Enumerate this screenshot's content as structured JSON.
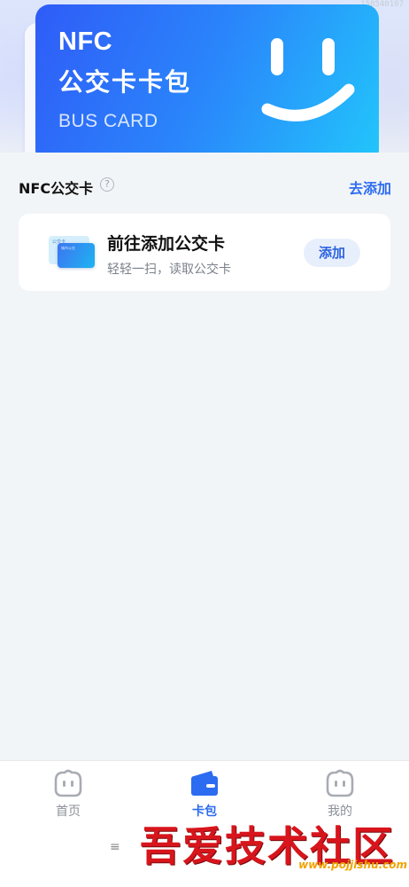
{
  "hero": {
    "id_text": "158540107",
    "card": {
      "nfc": "NFC",
      "title": "公交卡卡包",
      "subtitle": "BUS CARD"
    }
  },
  "section": {
    "title": "NFC公交卡",
    "help": "?",
    "link": "去添加"
  },
  "add_card": {
    "mini_back_label": "公交卡",
    "mini_front_label": "城市公交",
    "title": "前往添加公交卡",
    "description": "轻轻一扫，读取公交卡",
    "button": "添加"
  },
  "nav": {
    "items": [
      {
        "label": "首页",
        "icon": "home-face-icon",
        "active": false
      },
      {
        "label": "卡包",
        "icon": "wallet-icon",
        "active": true
      },
      {
        "label": "我的",
        "icon": "profile-face-icon",
        "active": false
      }
    ],
    "menu_glyph": "≡"
  },
  "watermark": {
    "text": "吾爱技术社区",
    "url": "www.pojjishu.com"
  },
  "colors": {
    "accent": "#2c6cf1",
    "card_gradient_start": "#2f5cf7",
    "card_gradient_end": "#22c6fb",
    "background": "#f2f5f7"
  }
}
